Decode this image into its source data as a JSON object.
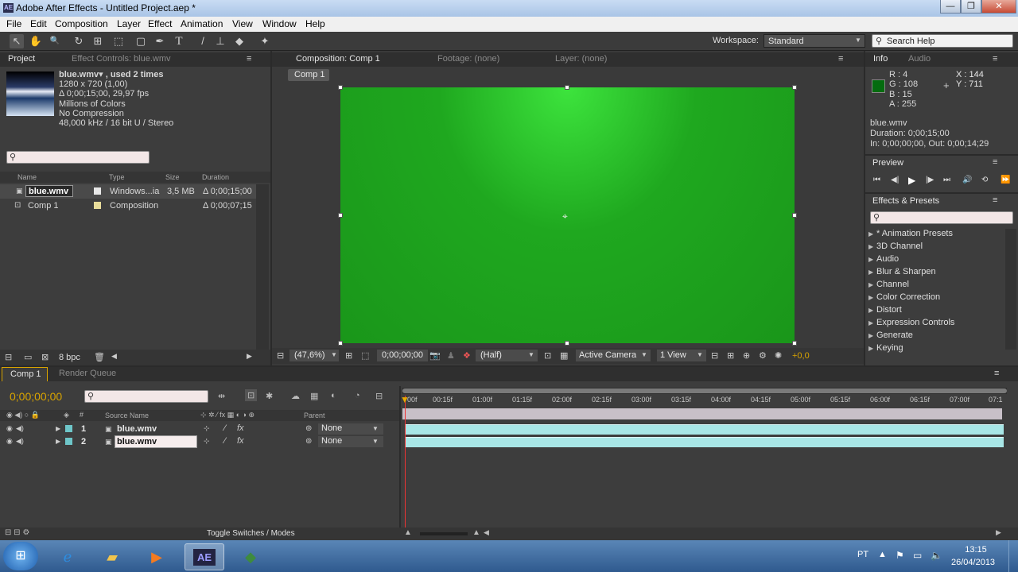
{
  "window": {
    "title": "Adobe After Effects - Untitled Project.aep *",
    "app_badge": "AE",
    "btn_min": "—",
    "btn_max": "❐",
    "btn_close": "✕"
  },
  "menu": [
    "File",
    "Edit",
    "Composition",
    "Layer",
    "Effect",
    "Animation",
    "View",
    "Window",
    "Help"
  ],
  "toolbar": {
    "tools": [
      "↖",
      "✋",
      "🔍",
      "↻",
      "⊞",
      "⬚",
      "▢",
      "✒",
      "T",
      "/",
      "⊥",
      "◆",
      "✦"
    ],
    "workspace_label": "Workspace:",
    "workspace_value": "Standard",
    "search_help": "Search Help"
  },
  "project_panel": {
    "tab_project": "Project",
    "tab_effect_controls": "Effect Controls: blue.wmv",
    "menu_icon": "≡",
    "info_lines": [
      "blue.wmv▾ , used 2 times",
      "1280 x 720 (1,00)",
      "Δ 0;00;15;00, 29,97 fps",
      "Millions of Colors",
      "No Compression",
      "48,000 kHz / 16 bit U / Stereo"
    ],
    "search_placeholder": "",
    "columns": [
      "Name",
      "Type",
      "Size",
      "Duration"
    ],
    "items": [
      {
        "name": "blue.wmv",
        "type": "Windows...ia",
        "size": "3,5 MB",
        "duration": "Δ 0;00;15;00",
        "label_color": "#e8e8e8"
      },
      {
        "name": "Comp 1",
        "type": "Composition",
        "size": "",
        "duration": "Δ 0;00;07;15",
        "label_color": "#e8dc9a"
      }
    ],
    "bpc": "8 bpc"
  },
  "comp_panel": {
    "tab_composition": "Composition: Comp 1",
    "tab_footage": "Footage: (none)",
    "tab_layer": "Layer: (none)",
    "breadcrumb": "Comp 1",
    "zoom": "(47,6%)",
    "timecode": "0;00;00;00",
    "resolution": "(Half)",
    "camera": "Active Camera",
    "views": "1 View",
    "exposure": "+0,0",
    "canvas_color": "#1ea41e"
  },
  "info_panel": {
    "tab_info": "Info",
    "tab_audio": "Audio",
    "swatch_color": "#046c0f",
    "rgba": [
      "R : 4",
      "G : 108",
      "B : 15",
      "A : 255"
    ],
    "x": "X : 144",
    "y": "Y : 711",
    "clip_name": "blue.wmv",
    "duration": "Duration: 0;00;15;00",
    "in_out": "In: 0;00;00;00, Out: 0;00;14;29"
  },
  "preview_panel": {
    "title": "Preview",
    "controls": [
      "⏮",
      "◀|",
      "▶",
      "|▶",
      "⏭",
      "🔊",
      "⟲",
      "⏩"
    ]
  },
  "effects_panel": {
    "title": "Effects & Presets",
    "items": [
      "* Animation Presets",
      "3D Channel",
      "Audio",
      "Blur & Sharpen",
      "Channel",
      "Color Correction",
      "Distort",
      "Expression Controls",
      "Generate",
      "Keying"
    ]
  },
  "timeline": {
    "tab_comp": "Comp 1",
    "tab_render": "Render Queue",
    "timecode": "0;00;00;00",
    "col_source": "Source Name",
    "col_parent": "Parent",
    "layers": [
      {
        "num": "1",
        "name": "blue.wmv",
        "parent": "None",
        "fx": "fx"
      },
      {
        "num": "2",
        "name": "blue.wmv",
        "parent": "None",
        "fx": "fx"
      }
    ],
    "ruler": [
      "00f",
      "00:15f",
      "01:00f",
      "01:15f",
      "02:00f",
      "02:15f",
      "03:00f",
      "03:15f",
      "04:00f",
      "04:15f",
      "05:00f",
      "05:15f",
      "06:00f",
      "06:15f",
      "07:00f",
      "07:1"
    ],
    "toggle_label": "Toggle Switches / Modes"
  },
  "taskbar": {
    "lang": "PT",
    "time": "13:15",
    "date": "26/04/2013",
    "apps": [
      "ie-icon",
      "folder-icon",
      "media-icon",
      "ae-icon",
      "app-icon"
    ],
    "ae_label": "AE"
  }
}
